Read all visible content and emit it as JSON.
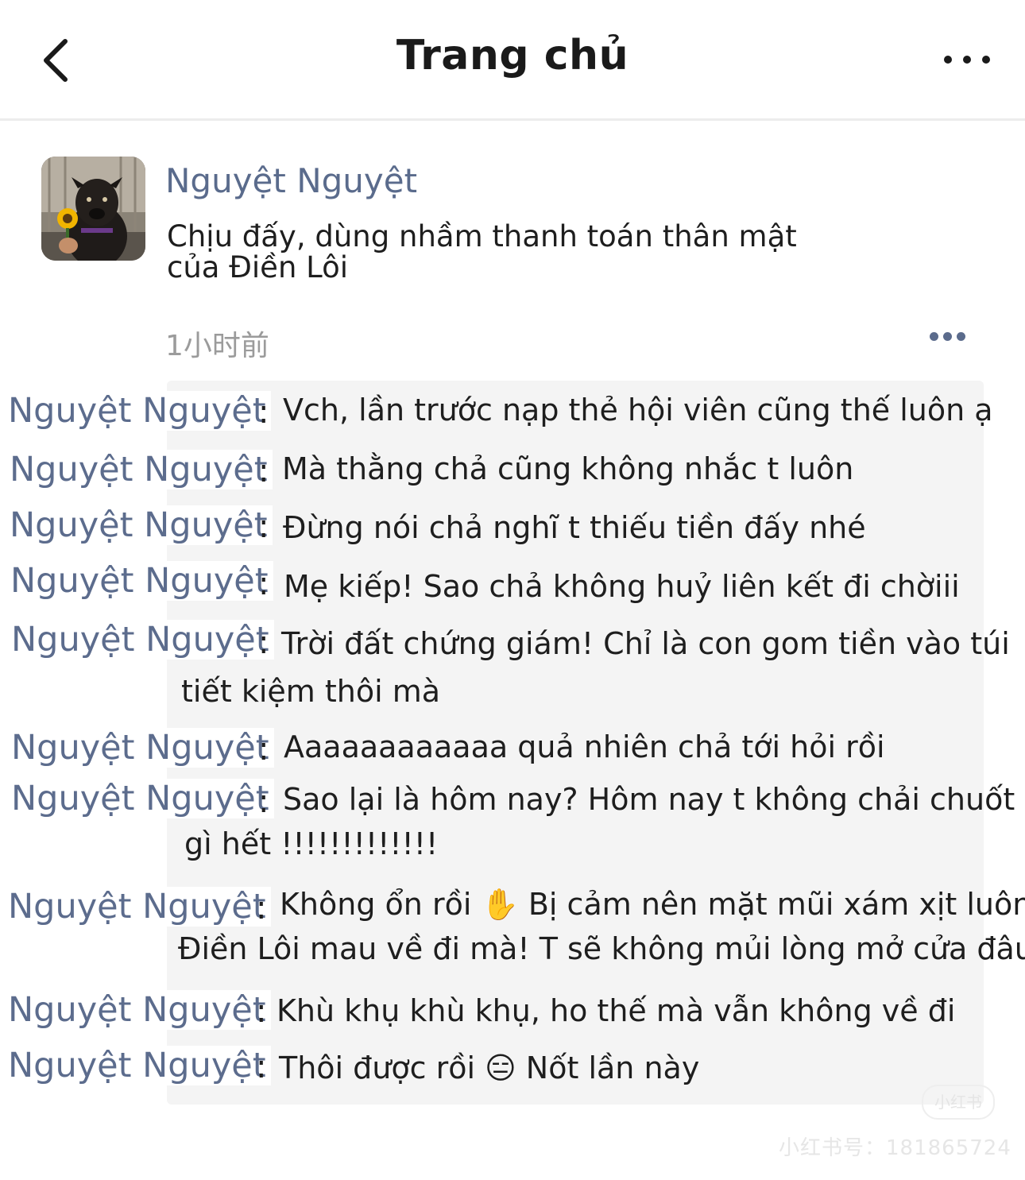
{
  "header": {
    "title": "Trang chủ"
  },
  "post": {
    "author": "Nguyệt Nguyệt",
    "text_line1": "Chịu đấy, dùng nhầm thanh toán thân mật",
    "text_line2": "của Điền Lôi",
    "time": "1小时前"
  },
  "comments": [
    {
      "name": "Nguyệt Nguyệt",
      "colon": ":",
      "text": "Vch, lần trước nạp thẻ hội viên cũng thế luôn ạ",
      "cont": ""
    },
    {
      "name": "Nguyệt Nguyệt",
      "colon": ":",
      "text": "Mà thằng chả cũng không nhắc t luôn",
      "cont": ""
    },
    {
      "name": "Nguyệt Nguyệt",
      "colon": ":",
      "text": "Đừng nói chả nghĩ t thiếu tiền đấy nhé",
      "cont": ""
    },
    {
      "name": "Nguyệt Nguyệt",
      "colon": ":",
      "text": "Mẹ kiếp! Sao chả không huỷ liên kết đi chờiii",
      "cont": ""
    },
    {
      "name": "Nguyệt Nguyệt",
      "colon": ":",
      "text": "Trời đất chứng giám! Chỉ là con gom tiền vào túi",
      "cont": "tiết kiệm thôi mà"
    },
    {
      "name": "Nguyệt Nguyệt",
      "colon": ":",
      "text": "Aaaaaaaaaaaa quả nhiên chả tới hỏi rồi",
      "cont": ""
    },
    {
      "name": "Nguyệt Nguyệt",
      "colon": ":",
      "text": "Sao lại là hôm nay? Hôm nay t không chải chuốt",
      "cont": "gì hết !!!!!!!!!!!!!"
    },
    {
      "name": "Nguyệt Nguyệt",
      "colon": ":",
      "text": "Không ổn rồi ✋ Bị cảm nên mặt mũi xám xịt luôn",
      "cont": "Điền Lôi mau về đi mà! T sẽ không mủi lòng mở cửa đâu"
    },
    {
      "name": "Nguyệt Nguyệt",
      "colon": ":",
      "text": "Khù khụ khù khụ, ho thế mà vẫn không về đi",
      "cont": ""
    },
    {
      "name": "Nguyệt Nguyệt",
      "colon": ":",
      "text": "Thôi được rồi 😑 Nốt lần này",
      "cont": ""
    }
  ],
  "watermark": {
    "logo": "小红书",
    "id": "小红书号：181865724"
  }
}
